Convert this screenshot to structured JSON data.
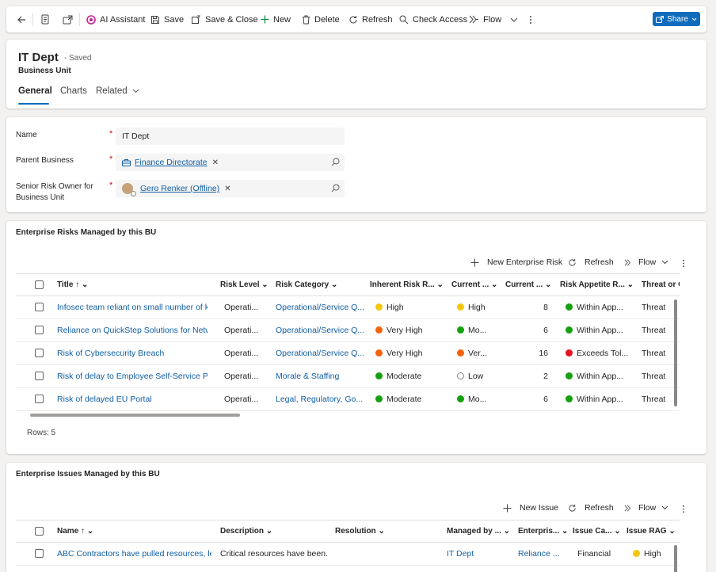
{
  "toolbar": {
    "ai_assistant": "AI Assistant",
    "save": "Save",
    "save_close": "Save & Close",
    "new": "New",
    "delete": "Delete",
    "refresh": "Refresh",
    "check_access": "Check Access",
    "flow": "Flow",
    "share": "Share"
  },
  "header": {
    "title": "IT Dept",
    "saved_status": "- Saved",
    "entity_type": "Business Unit",
    "tabs": [
      "General",
      "Charts",
      "Related"
    ]
  },
  "form": {
    "name_label": "Name",
    "name_value": "IT Dept",
    "parent_label": "Parent Business",
    "parent_value": "Finance Directorate",
    "owner_label_1": "Senior Risk Owner for",
    "owner_label_2": "Business Unit",
    "owner_value": "Gero Renker (Offline)"
  },
  "risks": {
    "title": "Enterprise Risks Managed by this BU",
    "cmd_new": "New Enterprise Risk",
    "cmd_refresh": "Refresh",
    "cmd_flow": "Flow",
    "columns": [
      "Title",
      "Risk Level",
      "Risk Category",
      "Inherent Risk R...",
      "Current ...",
      "Current ...",
      "Risk Appetite R...",
      "Threat or O"
    ],
    "rows": [
      {
        "title": "Infosec team reliant on small number of k...",
        "level": "Operati...",
        "category": "Operational/Service Q...",
        "inherent": "High",
        "inherent_color": "#f2c80f",
        "current": "High",
        "current_color": "#f2c80f",
        "score": "8",
        "appetite": "Within App...",
        "appetite_color": "#13a10e",
        "threat": "Threat"
      },
      {
        "title": "Reliance on QuickStep Solutions for Netw...",
        "level": "Operati...",
        "category": "Operational/Service Q...",
        "inherent": "Very High",
        "inherent_color": "#f7630c",
        "current": "Mo...",
        "current_color": "#13a10e",
        "score": "6",
        "appetite": "Within App...",
        "appetite_color": "#13a10e",
        "threat": "Threat"
      },
      {
        "title": "Risk of Cybersecurity Breach",
        "level": "Operati...",
        "category": "Operational/Service Q...",
        "inherent": "Very High",
        "inherent_color": "#f7630c",
        "current": "Ver...",
        "current_color": "#f7630c",
        "score": "16",
        "appetite": "Exceeds Tol...",
        "appetite_color": "#e81123",
        "threat": "Threat"
      },
      {
        "title": "Risk of delay to Employee Self-Service Por...",
        "level": "Operati...",
        "category": "Morale & Staffing",
        "inherent": "Moderate",
        "inherent_color": "#13a10e",
        "current": "Low",
        "current_color": "none",
        "score": "2",
        "appetite": "Within App...",
        "appetite_color": "#13a10e",
        "threat": "Threat"
      },
      {
        "title": "Risk of delayed EU Portal",
        "level": "Operati...",
        "category": "Legal, Regulatory, Go...",
        "inherent": "Moderate",
        "inherent_color": "#13a10e",
        "current": "Mo...",
        "current_color": "#13a10e",
        "score": "6",
        "appetite": "Within App...",
        "appetite_color": "#13a10e",
        "threat": "Threat"
      }
    ],
    "rows_label": "Rows: 5"
  },
  "issues": {
    "title": "Enterprise Issues Managed by this BU",
    "cmd_new": "New Issue",
    "cmd_refresh": "Refresh",
    "cmd_flow": "Flow",
    "columns": [
      "Name",
      "Description",
      "Resolution",
      "Managed by ...",
      "Enterpris...",
      "Issue Ca...",
      "Issue RAG"
    ],
    "rows": [
      {
        "name": "ABC Contractors have pulled resources, le...",
        "description": "Critical resources have been...",
        "resolution": "",
        "managed_by": "IT Dept",
        "enterprise": "Reliance ...",
        "category": "Financial",
        "rag": "High",
        "rag_color": "#f2c80f"
      }
    ]
  }
}
